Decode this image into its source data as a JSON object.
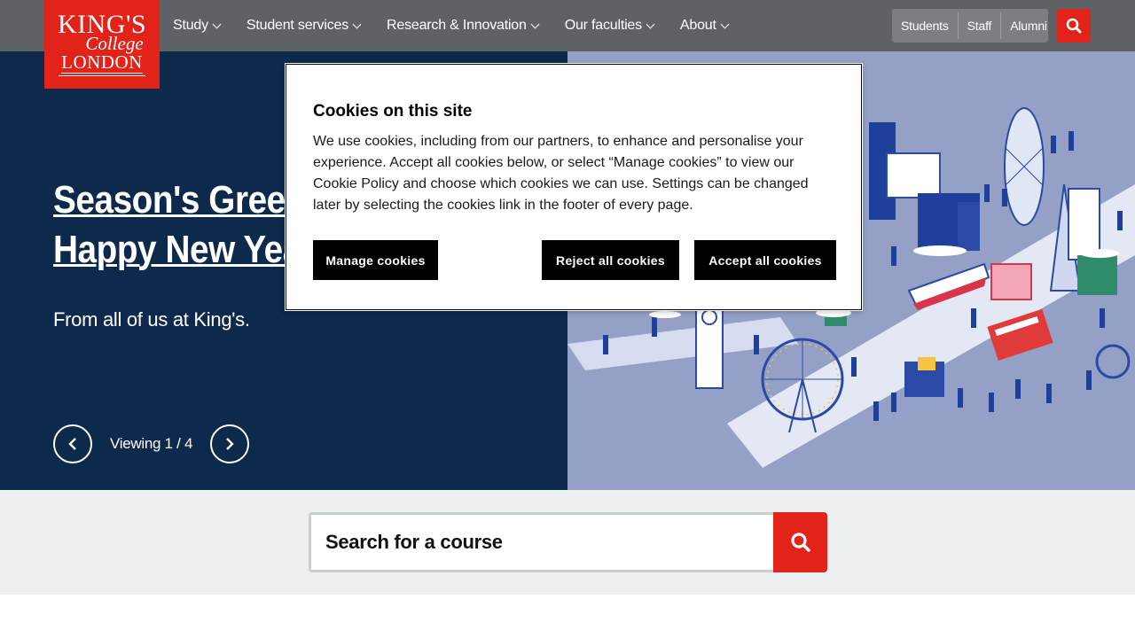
{
  "header": {
    "logo": {
      "line1": "KING'S",
      "line2": "College",
      "line3": "LONDON"
    },
    "nav": [
      {
        "label": "Study"
      },
      {
        "label": "Student services"
      },
      {
        "label": "Research & Innovation"
      },
      {
        "label": "Our faculties"
      },
      {
        "label": "About"
      }
    ],
    "audience": [
      {
        "label": "Students"
      },
      {
        "label": "Staff"
      },
      {
        "label": "Alumni"
      }
    ],
    "search_icon": "search-icon"
  },
  "hero": {
    "title_line1": "Season's Greetings and",
    "title_line2": "Happy New Year",
    "subtitle": "From all of us at King's.",
    "viewing": "Viewing 1 / 4"
  },
  "course_search": {
    "placeholder": "Search for a course"
  },
  "cookie_banner": {
    "title": "Cookies on this site",
    "body": "We use cookies, including from our partners, to enhance and personalise your experience. Accept all cookies below, or select “Manage cookies” to view our Cookie Policy and choose which cookies we can use. Settings can be changed later by selecting the cookies link in the footer of every page.",
    "manage_label": "Manage cookies",
    "reject_label": "Reject all cookies",
    "accept_label": "Accept all cookies"
  },
  "colors": {
    "brand_red": "#e2231a",
    "nav_grey": "#5e6266",
    "hero_navy": "#0d2a4c",
    "illustration_bg": "#94a0c6"
  }
}
